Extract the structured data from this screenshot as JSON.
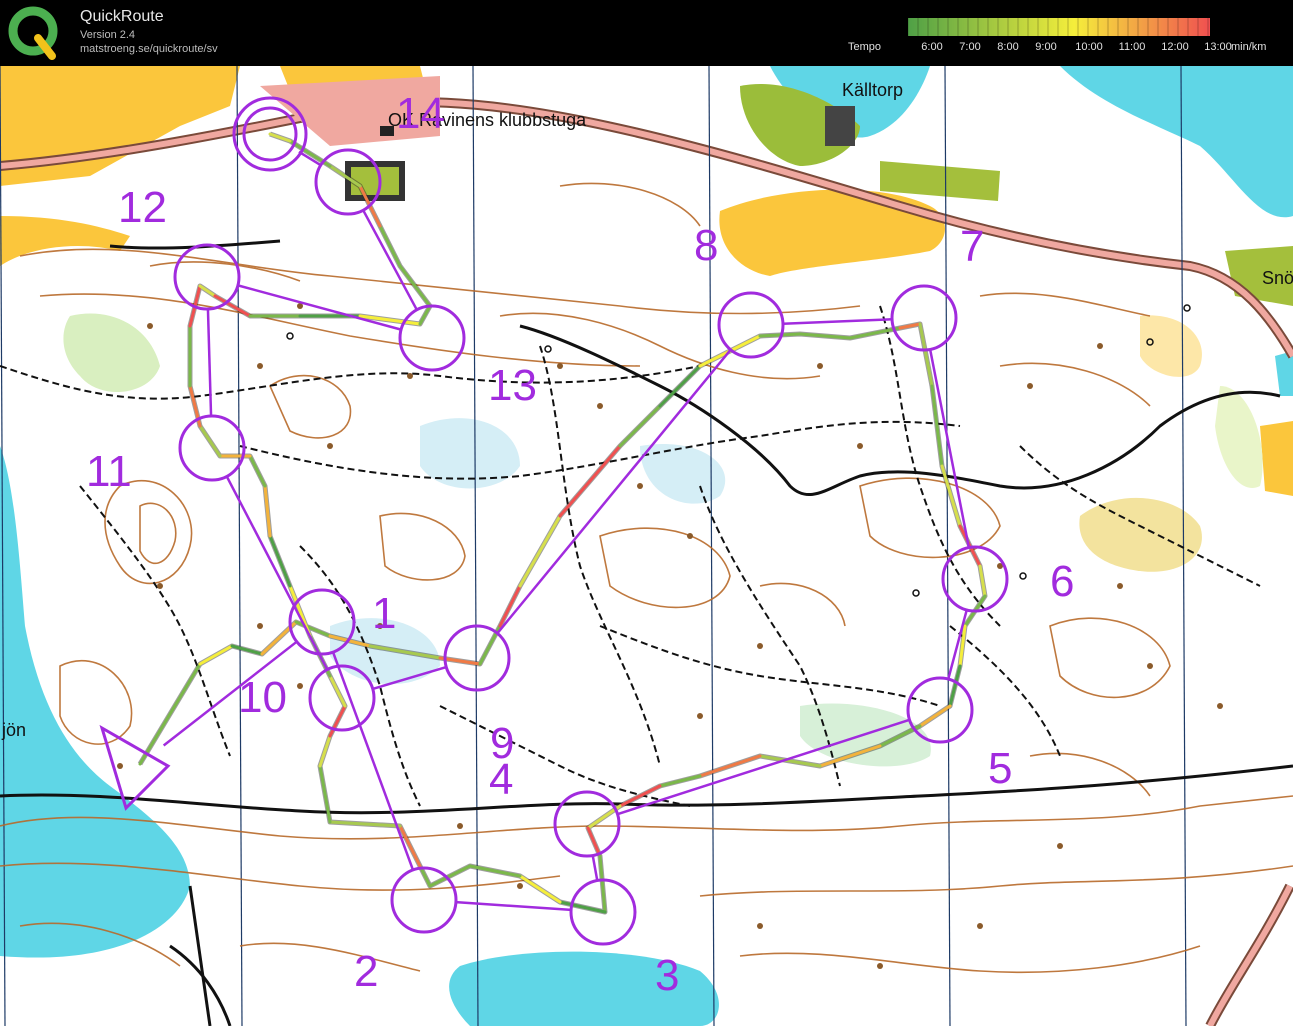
{
  "header": {
    "app_name": "QuickRoute",
    "version": "Version 2.4",
    "url": "matstroeng.se/quickroute/sv",
    "tempo_label": "Tempo",
    "unit": "min/km",
    "scale_ticks": [
      "6:00",
      "7:00",
      "8:00",
      "9:00",
      "10:00",
      "11:00",
      "12:00",
      "13:00"
    ],
    "scale_colors": {
      "start": "#4fa046",
      "mid": "#f5ee3b",
      "end": "#f05050"
    }
  },
  "map": {
    "place_names": {
      "kalltorp": "Källtorp",
      "klubbstuga": "OK Ravinens klubbstuga",
      "sno": "Snö",
      "sjon": "jön"
    },
    "controls": [
      {
        "label": "1"
      },
      {
        "label": "2"
      },
      {
        "label": "3"
      },
      {
        "label": "4"
      },
      {
        "label": "5"
      },
      {
        "label": "6"
      },
      {
        "label": "7"
      },
      {
        "label": "8"
      },
      {
        "label": "9"
      },
      {
        "label": "10"
      },
      {
        "label": "11"
      },
      {
        "label": "12"
      },
      {
        "label": "13"
      },
      {
        "label": "14"
      }
    ],
    "course_color": "#a12bde",
    "route_color": "#7bb84a"
  }
}
